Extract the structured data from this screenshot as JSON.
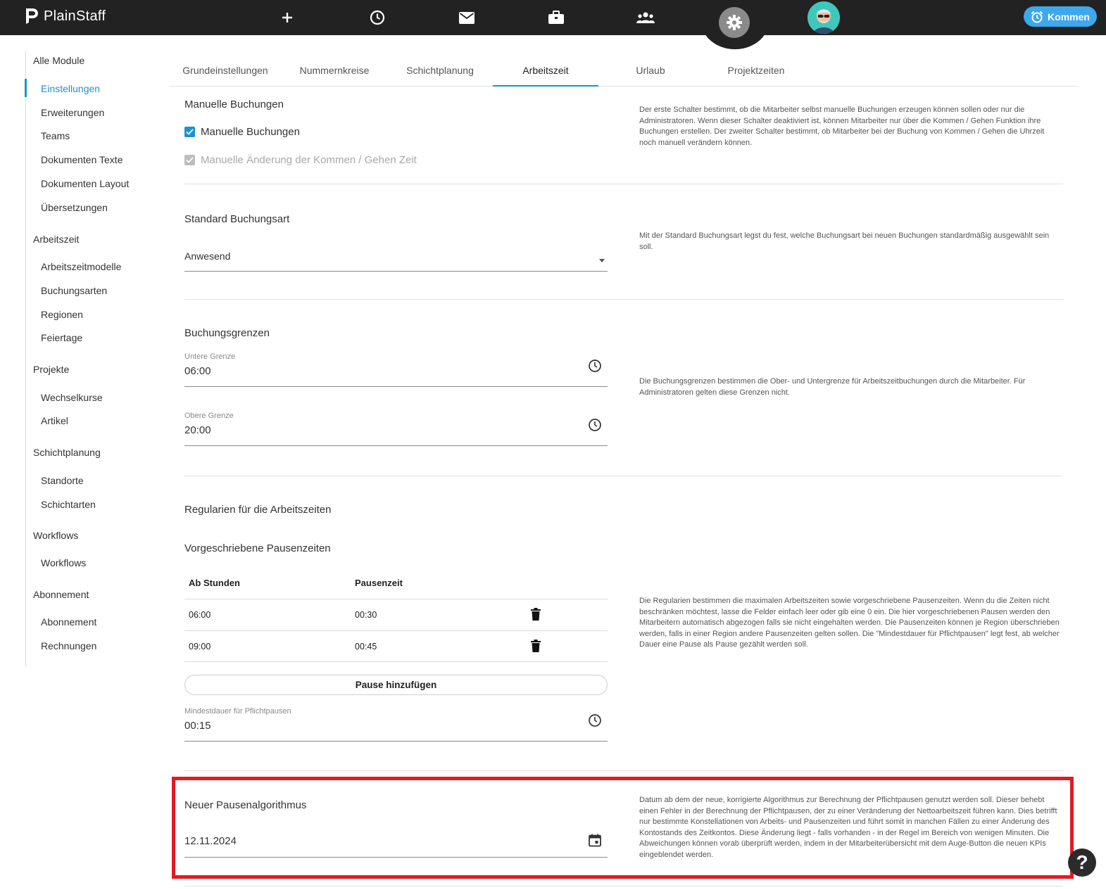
{
  "app": {
    "name": "PlainStaff"
  },
  "topnav": {
    "icons": [
      "plus-icon",
      "clock-icon",
      "mail-icon",
      "briefcase-icon",
      "people-icon",
      "gear-icon"
    ],
    "kommen_label": "Kommen"
  },
  "sidebar": {
    "all_modules": "Alle Module",
    "items": [
      {
        "label": "Einstellungen",
        "type": "sub",
        "active": true
      },
      {
        "label": "Erweiterungen",
        "type": "sub"
      },
      {
        "label": "Teams",
        "type": "sub"
      },
      {
        "label": "Dokumenten Texte",
        "type": "sub"
      },
      {
        "label": "Dokumenten Layout",
        "type": "sub"
      },
      {
        "label": "Übersetzungen",
        "type": "sub"
      },
      {
        "label": "Arbeitszeit",
        "type": "group"
      },
      {
        "label": "Arbeitszeitmodelle",
        "type": "sub"
      },
      {
        "label": "Buchungsarten",
        "type": "sub"
      },
      {
        "label": "Regionen",
        "type": "sub"
      },
      {
        "label": "Feiertage",
        "type": "sub"
      },
      {
        "label": "Projekte",
        "type": "group"
      },
      {
        "label": "Wechselkurse",
        "type": "sub"
      },
      {
        "label": "Artikel",
        "type": "sub"
      },
      {
        "label": "Schichtplanung",
        "type": "group"
      },
      {
        "label": "Standorte",
        "type": "sub"
      },
      {
        "label": "Schichtarten",
        "type": "sub"
      },
      {
        "label": "Workflows",
        "type": "group"
      },
      {
        "label": "Workflows",
        "type": "sub"
      },
      {
        "label": "Abonnement",
        "type": "group"
      },
      {
        "label": "Abonnement",
        "type": "sub"
      },
      {
        "label": "Rechnungen",
        "type": "sub"
      }
    ]
  },
  "tabs": [
    {
      "label": "Grundeinstellungen"
    },
    {
      "label": "Nummernkreise"
    },
    {
      "label": "Schichtplanung"
    },
    {
      "label": "Arbeitszeit",
      "active": true
    },
    {
      "label": "Urlaub"
    },
    {
      "label": "Projektzeiten"
    }
  ],
  "manual": {
    "title": "Manuelle Buchungen",
    "checkbox1": "Manuelle Buchungen",
    "checkbox2": "Manuelle Änderung der Kommen / Gehen Zeit",
    "desc": "Der erste Schalter bestimmt, ob die Mitarbeiter selbst manuelle Buchungen erzeugen können sollen oder nur die Administratoren. Wenn dieser Schalter deaktiviert ist, können Mitarbeiter nur über die Kommen / Gehen Funktion ihre Buchungen erstellen. Der zweiter Schalter bestimmt, ob Mitarbeiter bei der Buchung von Kommen / Gehen die Uhrzeit noch manuell verändern können."
  },
  "standard": {
    "title": "Standard Buchungsart",
    "value": "Anwesend",
    "desc": "Mit der Standard Buchungsart legst du fest, welche Buchungsart bei neuen Buchungen standardmäßig ausgewählt sein soll."
  },
  "limits": {
    "title": "Buchungsgrenzen",
    "lower_label": "Untere Grenze",
    "lower_value": "06:00",
    "upper_label": "Obere Grenze",
    "upper_value": "20:00",
    "desc": "Die Buchungsgrenzen bestimmen die Ober- und Untergrenze für Arbeitszeitbuchungen durch die Mitarbeiter. Für Administratoren gelten diese Grenzen nicht."
  },
  "rules": {
    "title": "Regularien für die Arbeitszeiten",
    "subtitle": "Vorgeschriebene Pausenzeiten",
    "col_hours": "Ab Stunden",
    "col_break": "Pausenzeit",
    "rows": [
      {
        "hours": "06:00",
        "break": "00:30"
      },
      {
        "hours": "09:00",
        "break": "00:45"
      }
    ],
    "add_button": "Pause hinzufügen",
    "min_label": "Mindestdauer für Pflichtpausen",
    "min_value": "00:15",
    "desc": "Die Regularien bestimmen die maximalen Arbeitszeiten sowie vorgeschriebene Pausenzeiten. Wenn du die Zeiten nicht beschränken möchtest, lasse die Felder einfach leer oder gib eine 0 ein. Die hier vorgeschriebenen Pausen werden den Mitarbeitern automatisch abgezogen falls sie nicht eingehalten werden. Die Pausenzeiten können je Region überschrieben werden, falls in einer Region andere Pausenzeiten gelten sollen. Die \"Mindestdauer für Pflichtpausen\" legt fest, ab welcher Dauer eine Pause als Pause gezählt werden soll."
  },
  "algorithm": {
    "title": "Neuer Pausenalgorithmus",
    "value": "12.11.2024",
    "desc": "Datum ab dem der neue, korrigierte Algorithmus zur Berechnung der Pflichtpausen genutzt werden soll. Dieser behebt einen Fehler in der Berechnung der Pflichtpausen, der zu einer Veränderung der Nettoarbeitszeit führen kann. Dies betrifft nur bestimmte Konstellationen von Arbeits- und Pausenzeiten und führt somit in manchen Fällen zu einer Änderung des Kontostands des Zeitkontos. Diese Änderung liegt - falls vorhanden - in der Regel im Bereich von wenigen Minuten. Die Abweichungen können vorab überprüft werden, indem in der Mitarbeiterübersicht mit dem Auge-Button die neuen KPIs eingeblendet werden."
  },
  "help": {
    "label": "?"
  },
  "colors": {
    "accent": "#1a93d6",
    "highlight": "#e21b23",
    "topbar": "#222222",
    "kommen": "#3da8ee"
  }
}
